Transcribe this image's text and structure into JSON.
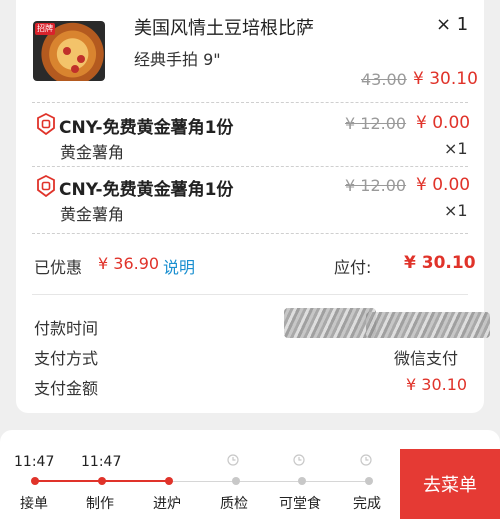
{
  "order_item": {
    "image_tag": "招牌",
    "name": "美国风情土豆培根比萨",
    "spec": "经典手拍 9\"",
    "qty": "× 1",
    "original_price": "43.00",
    "price": "¥ 30.10"
  },
  "coupons": [
    {
      "name": "CNY-免费黄金薯角1份",
      "original_price": "¥ 12.00",
      "price": "¥ 0.00",
      "item": "黄金薯角",
      "qty": "×1"
    },
    {
      "name": "CNY-免费黄金薯角1份",
      "original_price": "¥ 12.00",
      "price": "¥ 0.00",
      "item": "黄金薯角",
      "qty": "×1"
    }
  ],
  "summary": {
    "discount_label": "已优惠",
    "discount_value": "¥ 36.90",
    "explain_link": "说明",
    "payable_label": "应付:",
    "payable_value": "¥ 30.10"
  },
  "payment": {
    "time_label": "付款时间",
    "method_label": "支付方式",
    "method_value": "微信支付",
    "amount_label": "支付金额",
    "amount_value": "¥ 30.10"
  },
  "progress": {
    "steps": [
      {
        "label": "接单",
        "time": "11:47",
        "done": true
      },
      {
        "label": "制作",
        "time": "11:47",
        "done": true
      },
      {
        "label": "进炉",
        "time": "",
        "done": false
      },
      {
        "label": "质检",
        "time": "",
        "done": false
      },
      {
        "label": "可堂食",
        "time": "",
        "done": false
      },
      {
        "label": "完成",
        "time": "",
        "done": false
      }
    ],
    "cta_label": "去菜单"
  },
  "colors": {
    "accent": "#e0332a",
    "link": "#1a8fd0",
    "cta_bg": "#e53a34",
    "inactive": "#c8c8c8"
  }
}
